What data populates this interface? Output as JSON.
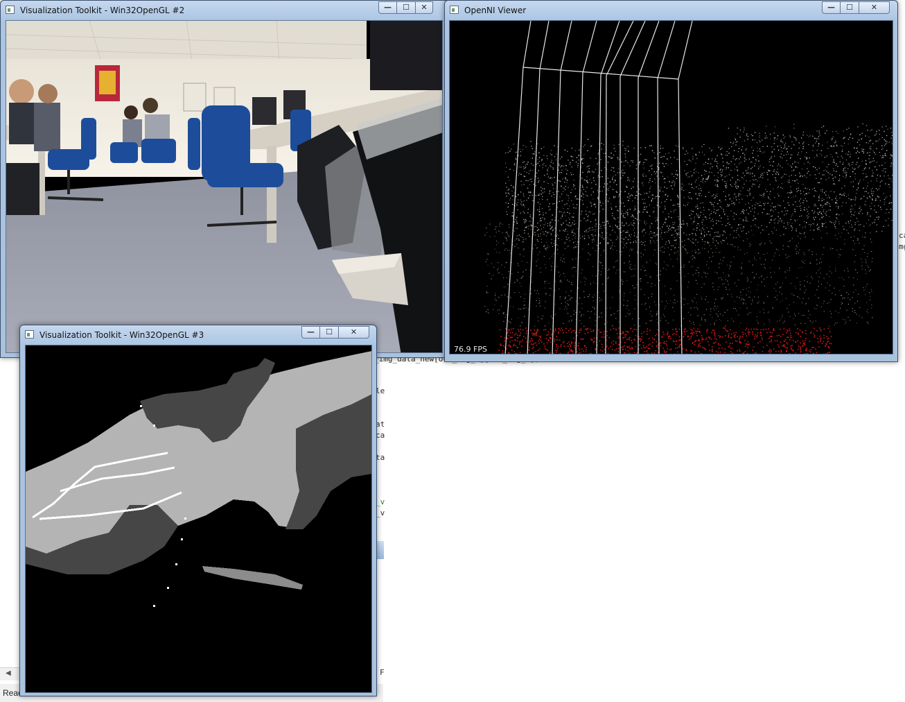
{
  "background": {
    "status_text": "Reac",
    "code_fragments": [
      {
        "text": "_img_data_new[ocs_img_n][ocs_img_c])",
        "green": false
      },
      {
        "text": "le",
        "green": false
      },
      {
        "text": "at",
        "green": false
      },
      {
        "text": "ca",
        "green": false
      },
      {
        "text": "ta",
        "green": false
      },
      {
        "text": "_v",
        "green": true
      },
      {
        "text": "_v",
        "green": false
      },
      {
        "text": "F",
        "green": false
      },
      {
        "text": "ca",
        "green": false
      },
      {
        "text": "mg",
        "green": false
      }
    ]
  },
  "windows": {
    "vtk2": {
      "title": "Visualization Toolkit - Win32OpenGL #2",
      "buttons": {
        "minimize": "—",
        "maximize": "☐",
        "close": "✕"
      }
    },
    "openni": {
      "title": "OpenNI Viewer",
      "fps": "76.9 FPS",
      "buttons": {
        "minimize": "—",
        "maximize": "☐",
        "close": "✕"
      }
    },
    "vtk3": {
      "title": "Visualization Toolkit - Win32OpenGL #3",
      "buttons": {
        "minimize": "—",
        "maximize": "☐",
        "close": "✕"
      }
    }
  },
  "colors": {
    "titlebar": "#aac4e2",
    "point_cloud_white": "#d8d8d8",
    "point_cloud_red": "#d01818",
    "segment_light": "#b4b4b4",
    "segment_dark": "#464646"
  }
}
